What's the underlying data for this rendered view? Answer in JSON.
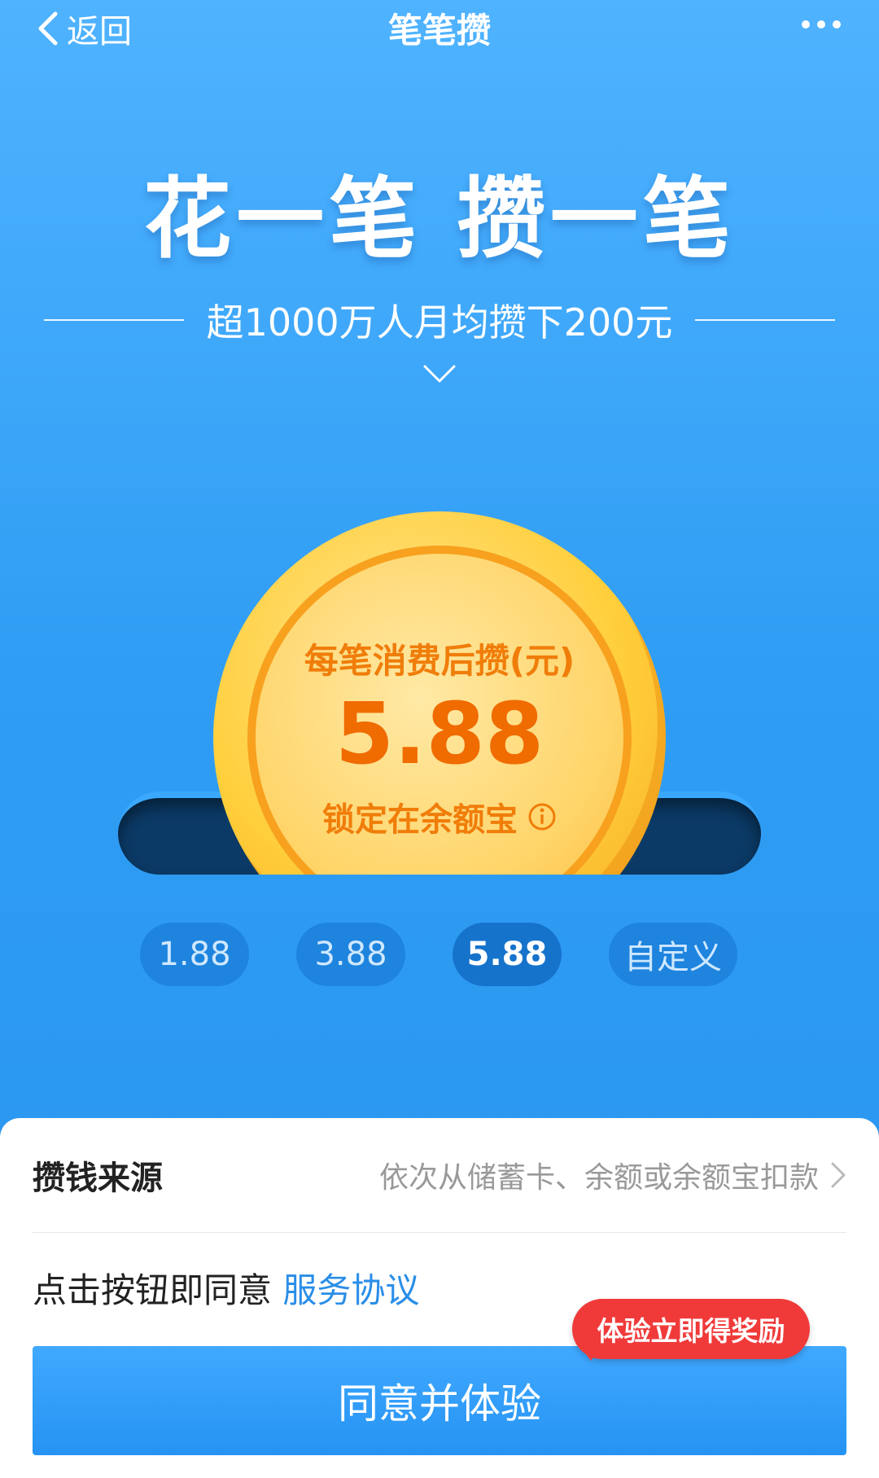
{
  "nav": {
    "back_label": "返回",
    "title": "笔笔攒",
    "more_icon": "more-dots-icon"
  },
  "hero": {
    "headline": "花一笔 攒一笔",
    "subline": "超1000万人月均攒下200元"
  },
  "coin": {
    "label": "每笔消费后攒(元)",
    "amount": "5.88",
    "lock_text": "锁定在余额宝"
  },
  "amount_options": [
    {
      "label": "1.88",
      "selected": false
    },
    {
      "label": "3.88",
      "selected": false
    },
    {
      "label": "5.88",
      "selected": true
    },
    {
      "label": "自定义",
      "selected": false
    }
  ],
  "source": {
    "label": "攒钱来源",
    "value": "依次从储蓄卡、余额或余额宝扣款"
  },
  "agreement": {
    "prefix": "点击按钮即同意",
    "link": "服务协议"
  },
  "promo_badge": "体验立即得奖励",
  "cta_label": "同意并体验",
  "colors": {
    "primary": "#2a95ee",
    "coin": "#ffce3a",
    "coin_text": "#f06b00",
    "badge": "#f03a3a",
    "link": "#2a8ee8"
  }
}
